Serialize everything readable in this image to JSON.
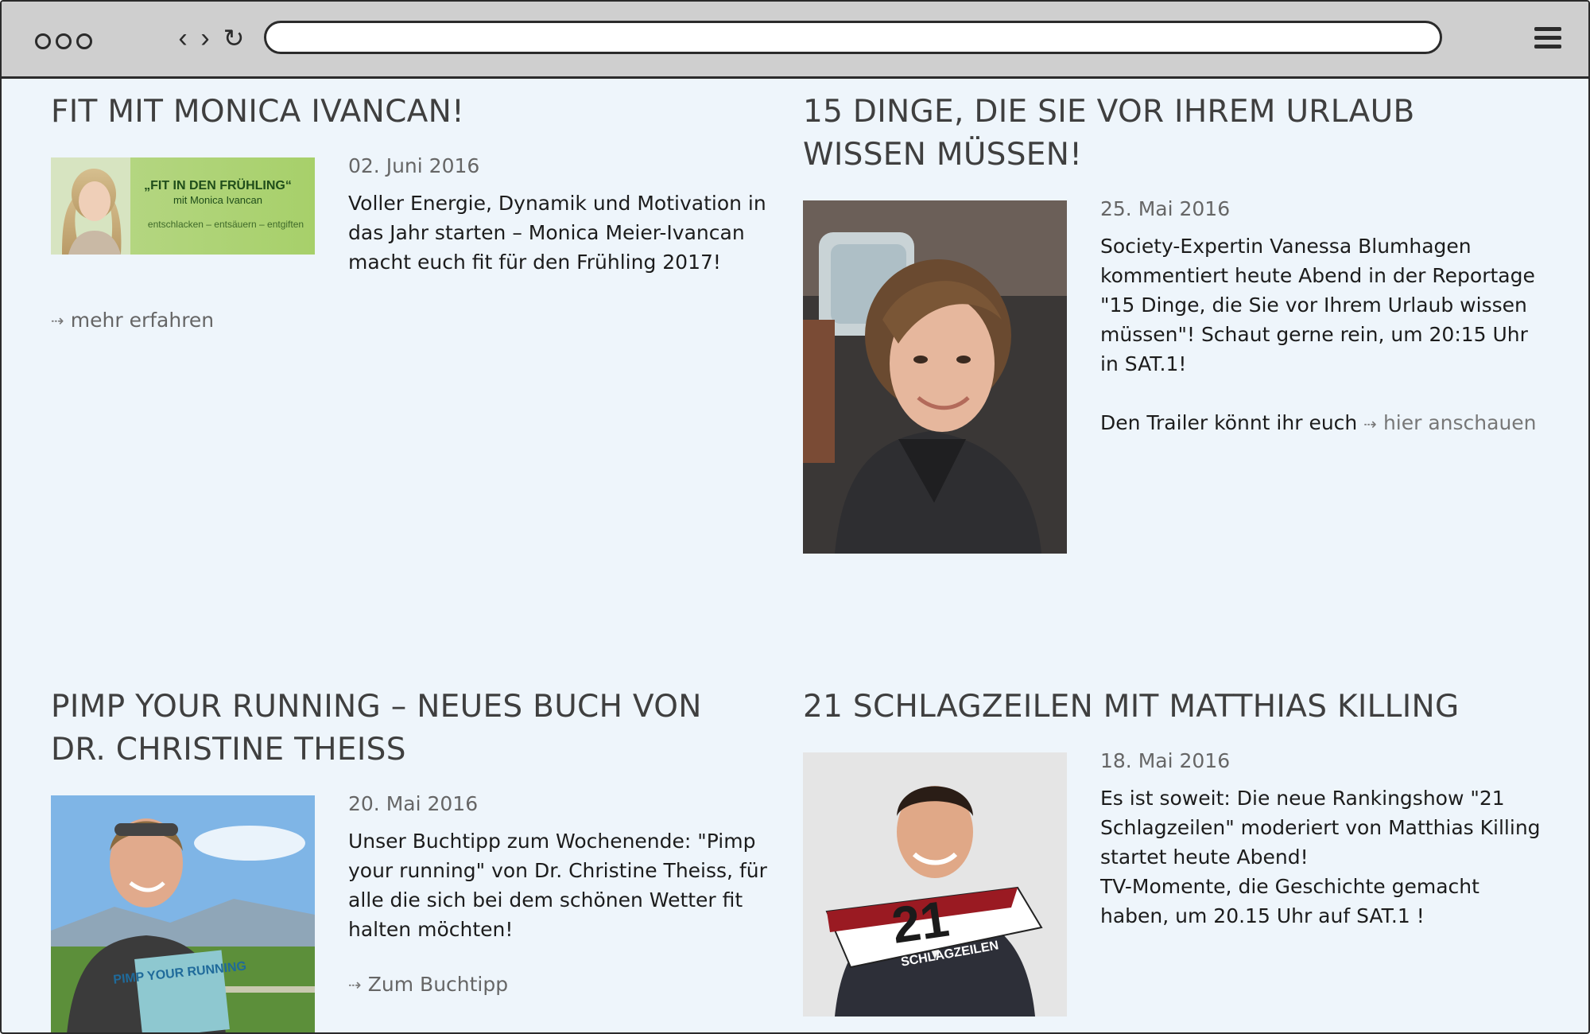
{
  "browser": {
    "url_value": "",
    "icons": {
      "back": "chevron-left-icon",
      "forward": "chevron-right-icon",
      "reload": "reload-icon",
      "menu": "hamburger-icon"
    }
  },
  "posts": [
    {
      "title": "FIT MIT MONICA IVANCAN!",
      "date": "02. Juni 2016",
      "text": "Voller Energie, Dynamik und Motivation in das Jahr starten – Monica Meier-Ivancan macht euch fit für den Frühling 2017!",
      "link": "mehr erfahren",
      "image_text": {
        "headline": "„FIT IN DEN FRÜHLING“",
        "sub": "mit Monica Ivancan",
        "tagline": "entschlacken – entsäuern – entgiften"
      }
    },
    {
      "title": "15 DINGE, DIE SIE VOR IHREM URLAUB WISSEN MÜSSEN!",
      "date": "25. Mai 2016",
      "text": "Society-Expertin Vanessa Blumhagen kommentiert heute Abend in der Reportage \"15 Dinge, die Sie vor Ihrem Urlaub wissen müssen\"! Schaut gerne rein, um 20:15 Uhr in SAT.1!",
      "trailer_prefix": "Den Trailer könnt ihr euch",
      "link": "hier anschauen"
    },
    {
      "title": "PIMP YOUR RUNNING – NEUES BUCH VON DR. CHRISTINE THEISS",
      "date": "20. Mai 2016",
      "text": "Unser Buchtipp zum Wochenende: \"Pimp your running\" von Dr. Christine Theiss, für alle die sich bei dem schönen Wetter fit halten möchten!",
      "link": "Zum Buchtipp",
      "image_text": {
        "book": "PIMP YOUR RUNNING"
      }
    },
    {
      "title": "21 SCHLAGZEILEN MIT MATTHIAS KILLING",
      "date": "18. Mai 2016",
      "text": "Es ist soweit: Die neue Rankingshow \"21 Schlagzeilen\" moderiert von Matthias Killing startet heute Abend!",
      "text2": "TV-Momente, die Geschichte gemacht haben, um 20.15 Uhr auf SAT.1 !",
      "image_text": {
        "number": "21",
        "label": "SCHLAGZEILEN"
      }
    }
  ]
}
